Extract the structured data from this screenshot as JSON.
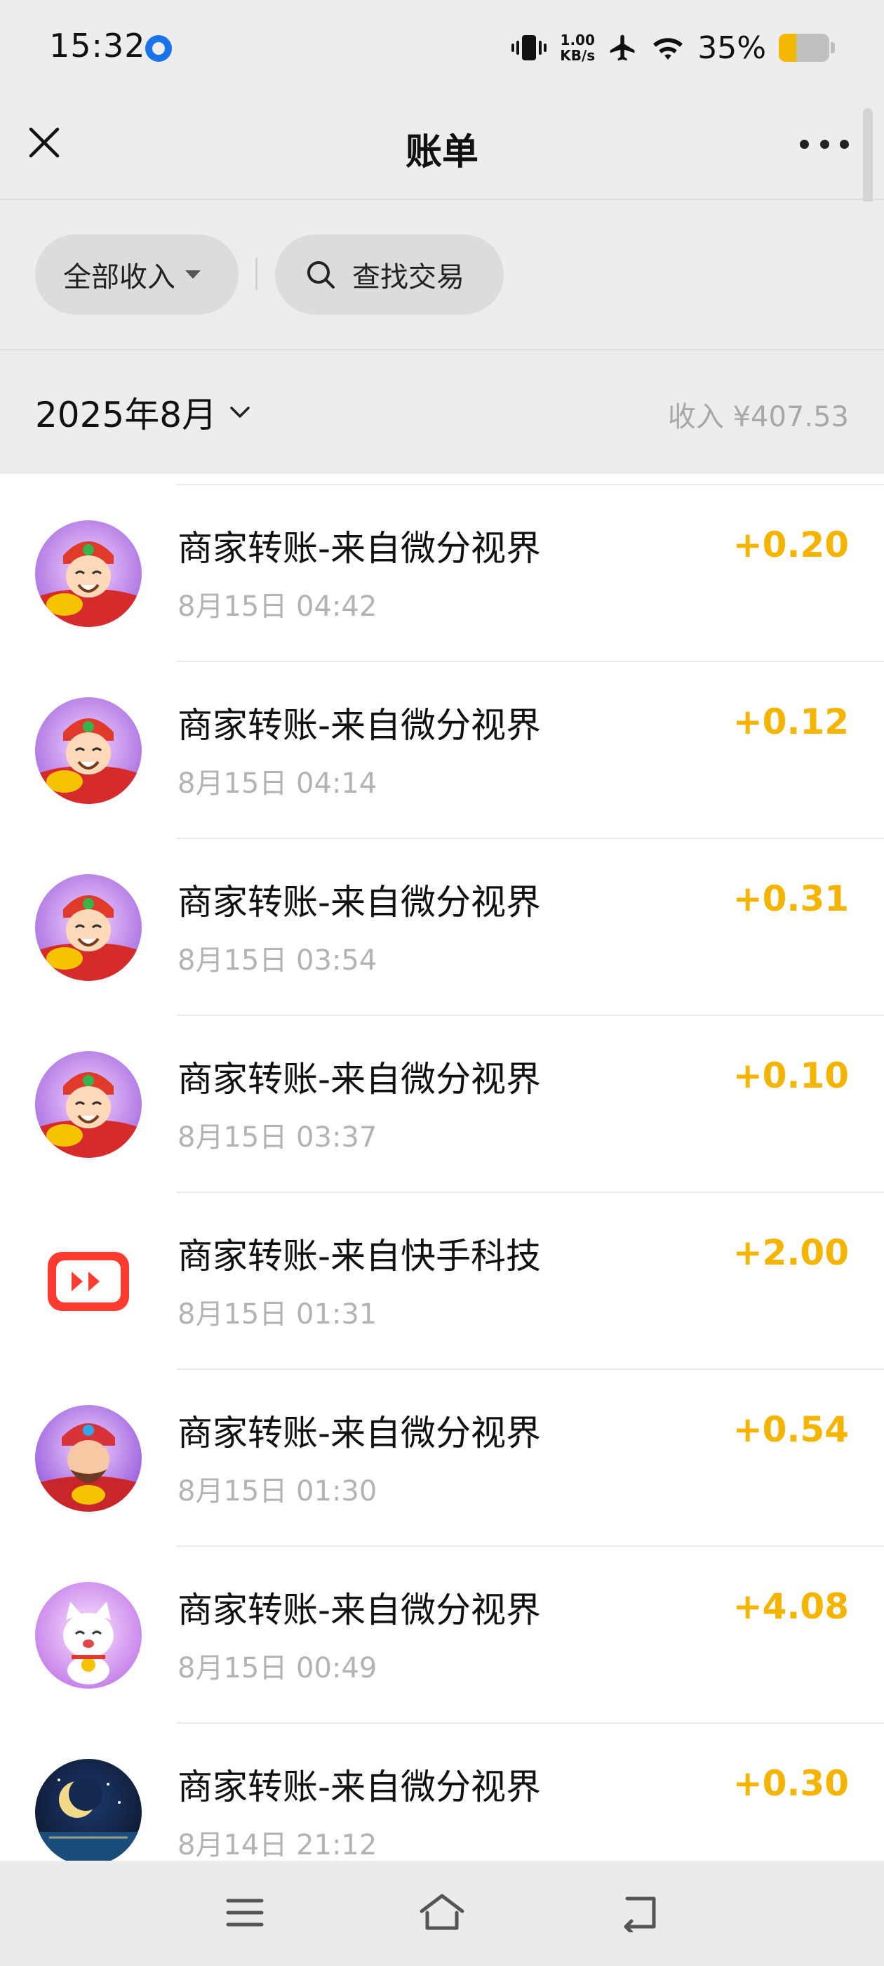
{
  "status_bar": {
    "time": "15:32",
    "net_speed_value": "1.00",
    "net_speed_unit": "KB/s",
    "battery_text": "35%",
    "battery_level": 0.35,
    "icons": [
      "vibrate-icon",
      "airplane-icon",
      "wifi-icon",
      "battery-icon"
    ]
  },
  "header": {
    "title": "账单"
  },
  "filters": {
    "type_filter_label": "全部收入",
    "search_label": "查找交易"
  },
  "month": {
    "label": "2025年8月",
    "income_summary": "收入 ¥407.53"
  },
  "colors": {
    "amount": "#f4b400",
    "background": "#ededed"
  },
  "transactions": [
    {
      "title": "商家转账-来自微分视界",
      "time": "8月15日 04:42",
      "amount": "+0.20",
      "avatar": "fortune-god-avatar"
    },
    {
      "title": "商家转账-来自微分视界",
      "time": "8月15日 04:14",
      "amount": "+0.12",
      "avatar": "fortune-god-avatar"
    },
    {
      "title": "商家转账-来自微分视界",
      "time": "8月15日 03:54",
      "amount": "+0.31",
      "avatar": "fortune-god-avatar"
    },
    {
      "title": "商家转账-来自微分视界",
      "time": "8月15日 03:37",
      "amount": "+0.10",
      "avatar": "fortune-god-avatar"
    },
    {
      "title": "商家转账-来自快手科技",
      "time": "8月15日 01:31",
      "amount": "+2.00",
      "avatar": "kuaishou-logo"
    },
    {
      "title": "商家转账-来自微分视界",
      "time": "8月15日 01:30",
      "amount": "+0.54",
      "avatar": "fortune-god-blue-avatar"
    },
    {
      "title": "商家转账-来自微分视界",
      "time": "8月15日 00:49",
      "amount": "+4.08",
      "avatar": "lucky-cat-avatar"
    },
    {
      "title": "商家转账-来自微分视界",
      "time": "8月14日 21:12",
      "amount": "+0.30",
      "avatar": "moon-night-avatar"
    }
  ],
  "nav": {
    "icons": [
      "menu-icon",
      "home-icon",
      "back-icon"
    ]
  }
}
